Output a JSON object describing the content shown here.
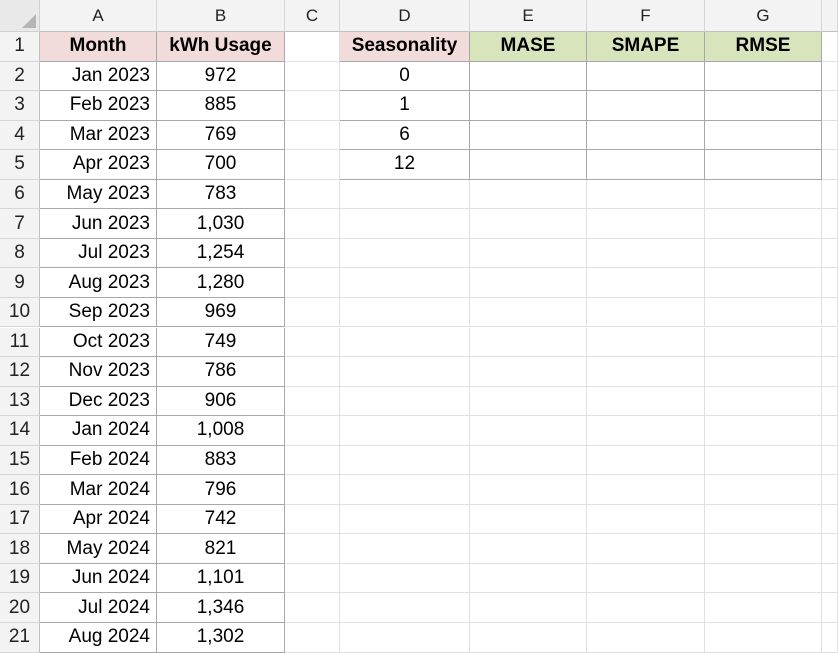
{
  "columns": [
    "A",
    "B",
    "C",
    "D",
    "E",
    "F",
    "G"
  ],
  "rows": [
    "1",
    "2",
    "3",
    "4",
    "5",
    "6",
    "7",
    "8",
    "9",
    "10",
    "11",
    "12",
    "13",
    "14",
    "15",
    "16",
    "17",
    "18",
    "19",
    "20",
    "21"
  ],
  "usage_table": {
    "headers": {
      "month": "Month",
      "kwh": "kWh Usage"
    },
    "rows": [
      {
        "month": "Jan 2023",
        "kwh": "972"
      },
      {
        "month": "Feb 2023",
        "kwh": "885"
      },
      {
        "month": "Mar 2023",
        "kwh": "769"
      },
      {
        "month": "Apr 2023",
        "kwh": "700"
      },
      {
        "month": "May 2023",
        "kwh": "783"
      },
      {
        "month": "Jun 2023",
        "kwh": "1,030"
      },
      {
        "month": "Jul 2023",
        "kwh": "1,254"
      },
      {
        "month": "Aug 2023",
        "kwh": "1,280"
      },
      {
        "month": "Sep 2023",
        "kwh": "969"
      },
      {
        "month": "Oct 2023",
        "kwh": "749"
      },
      {
        "month": "Nov 2023",
        "kwh": "786"
      },
      {
        "month": "Dec 2023",
        "kwh": "906"
      },
      {
        "month": "Jan 2024",
        "kwh": "1,008"
      },
      {
        "month": "Feb 2024",
        "kwh": "883"
      },
      {
        "month": "Mar 2024",
        "kwh": "796"
      },
      {
        "month": "Apr 2024",
        "kwh": "742"
      },
      {
        "month": "May 2024",
        "kwh": "821"
      },
      {
        "month": "Jun 2024",
        "kwh": "1,101"
      },
      {
        "month": "Jul 2024",
        "kwh": "1,346"
      },
      {
        "month": "Aug 2024",
        "kwh": "1,302"
      }
    ]
  },
  "metrics_table": {
    "headers": {
      "seasonality": "Seasonality",
      "mase": "MASE",
      "smape": "SMAPE",
      "rmse": "RMSE"
    },
    "rows": [
      {
        "seasonality": "0",
        "mase": "",
        "smape": "",
        "rmse": ""
      },
      {
        "seasonality": "1",
        "mase": "",
        "smape": "",
        "rmse": ""
      },
      {
        "seasonality": "6",
        "mase": "",
        "smape": "",
        "rmse": ""
      },
      {
        "seasonality": "12",
        "mase": "",
        "smape": "",
        "rmse": ""
      }
    ]
  },
  "colors": {
    "header_pink": "#f2dcdb",
    "header_green": "#d8e4bc"
  }
}
